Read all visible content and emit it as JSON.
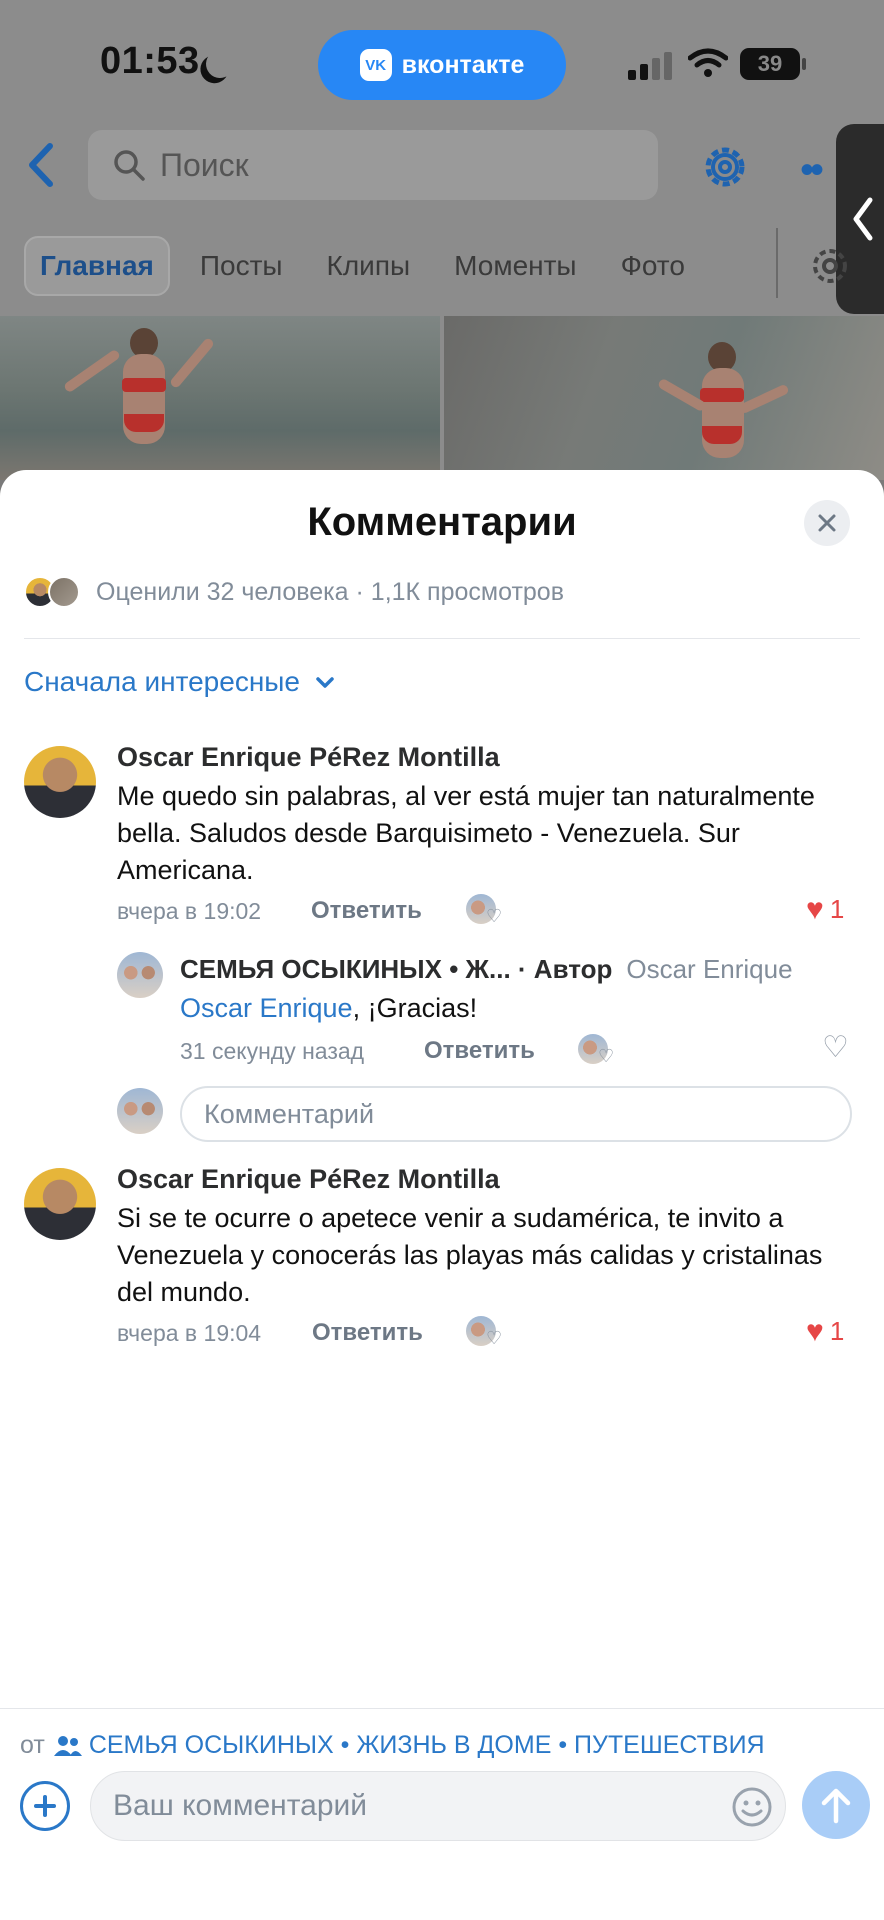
{
  "status_bar": {
    "time": "01:53",
    "battery": "39"
  },
  "app_pill": {
    "label": "вконтакте",
    "logo": "VK"
  },
  "header": {
    "search_placeholder": "Поиск"
  },
  "tabs": [
    {
      "label": "Главная",
      "active": true
    },
    {
      "label": "Посты"
    },
    {
      "label": "Клипы"
    },
    {
      "label": "Моменты"
    },
    {
      "label": "Фото"
    }
  ],
  "sheet": {
    "title": "Комментарии",
    "likes_text": "Оценили 32 человека · 1,1К просмотров",
    "sort_label": "Сначала интересные"
  },
  "comments": [
    {
      "author": "Oscar Enrique PéRez Montilla",
      "text": "Me quedo sin palabras, al ver está mujer tan naturalmente bella. Saludos desde Barquisimeto - Venezuela. Sur Americana.",
      "time": "вчера в 19:02",
      "reply_label": "Ответить",
      "likes": "1",
      "liked": true
    },
    {
      "author": "Oscar Enrique PéRez Montilla",
      "text": "Si se te ocurre o apetece venir a sudamérica, te invito a Venezuela y conocerás las playas más calidas y cristalinas del mundo.",
      "time": "вчера в 19:04",
      "reply_label": "Ответить",
      "likes": "1",
      "liked": true
    }
  ],
  "reply": {
    "author": "СЕМЬЯ ОСЫКИНЫХ • Ж... · Автор",
    "reply_to": "Oscar Enrique",
    "mention": "Oscar Enrique",
    "text": ", ¡Gracias!",
    "time": "31 секунду назад",
    "reply_label": "Ответить",
    "input_placeholder": "Комментарий"
  },
  "footer": {
    "from_label": "от",
    "from_group": "СЕМЬЯ ОСЫКИНЫХ • ЖИЗНЬ В ДОМЕ • ПУТЕШЕСТВИЯ",
    "input_placeholder": "Ваш комментарий"
  },
  "colors": {
    "accent": "#2a78c8",
    "vk_blue": "#2787f5",
    "like_red": "#e64646",
    "muted": "#818c99"
  }
}
